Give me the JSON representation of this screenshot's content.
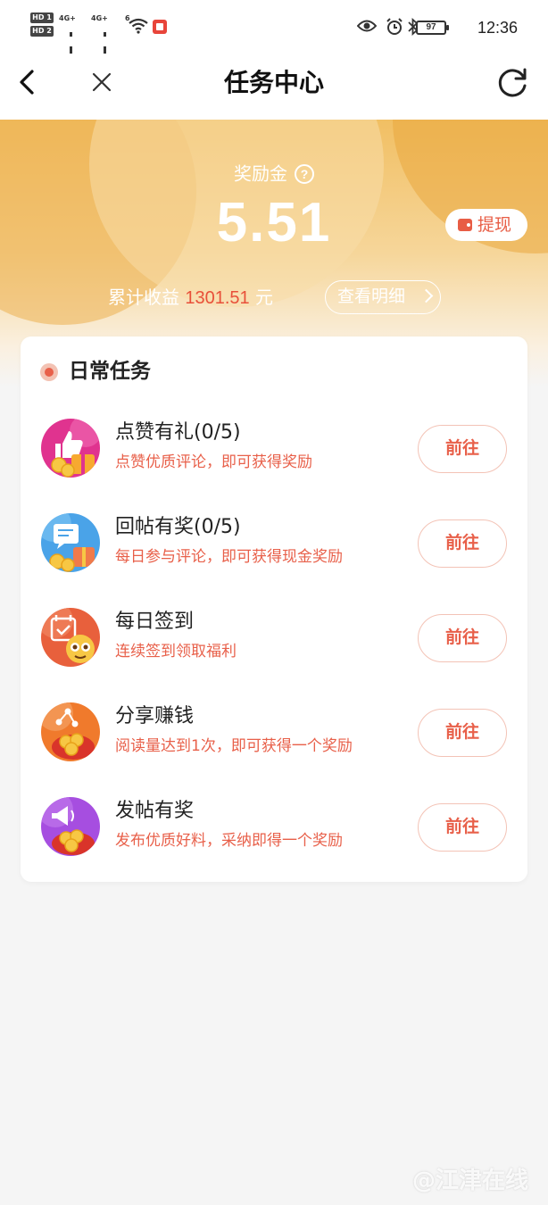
{
  "status_bar": {
    "hd1": "HD 1",
    "hd2": "HD 2",
    "net1": "4G+",
    "net2": "4G+",
    "wifi_num": "6",
    "battery": "97",
    "time": "12:36"
  },
  "nav": {
    "title": "任务中心"
  },
  "reward": {
    "label": "奖励金",
    "amount": "5.51",
    "withdraw_label": "提现",
    "cumulative_prefix": "累计收益",
    "cumulative_value": "1301.51",
    "cumulative_unit": "元",
    "detail_label": "查看明细"
  },
  "tasks": {
    "title": "日常任务",
    "items": [
      {
        "name": "点赞有礼(0/5)",
        "desc": "点赞优质评论，即可获得奖励",
        "button": "前往",
        "icon": "thumbs-up-icon",
        "color": "#e0338f"
      },
      {
        "name": "回帖有奖(0/5)",
        "desc": "每日参与评论，即可获得现金奖励",
        "button": "前往",
        "icon": "reply-icon",
        "color": "#4aa3e8"
      },
      {
        "name": "每日签到",
        "desc": "连续签到领取福利",
        "button": "前往",
        "icon": "calendar-icon",
        "color": "#e8603c"
      },
      {
        "name": "分享赚钱",
        "desc": "阅读量达到1次，即可获得一个奖励",
        "button": "前往",
        "icon": "share-icon",
        "color": "#f07a2c"
      },
      {
        "name": "发帖有奖",
        "desc": "发布优质好料，采纳即得一个奖励",
        "button": "前往",
        "icon": "megaphone-icon",
        "color": "#a64ee0"
      }
    ]
  },
  "watermark": "@江津在线"
}
